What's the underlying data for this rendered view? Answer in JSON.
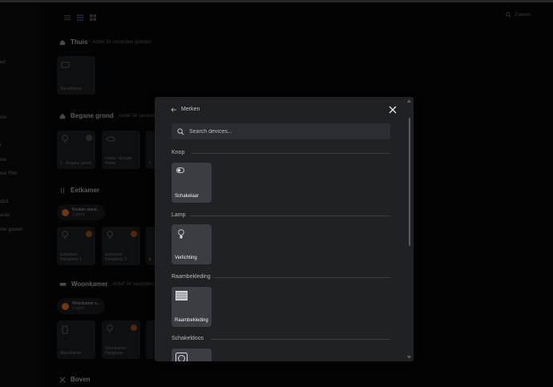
{
  "header": {
    "search_label": "Zoeken"
  },
  "sidebar": {
    "items": [
      "ed",
      "",
      "ner",
      "r",
      "ner",
      "ner Film",
      "dick",
      "ante",
      "ner gasten"
    ]
  },
  "background": {
    "sections": [
      {
        "title": "Thuis",
        "sub": "Actief 34 seconden geleden",
        "cards": [
          "Surveillance"
        ]
      },
      {
        "title": "Begane grond",
        "sub": "Actief 34 seconden",
        "cards": [
          "1 - Begane grond",
          "Living - Google Home",
          "F"
        ]
      },
      {
        "title": "Eetkamer",
        "sub": "",
        "chip": {
          "title": "Keuken stand...",
          "sub": "1 lights"
        },
        "cards": [
          "Eetkamer - Hanglamp 1",
          "Eetkamer - Hanglamp 2",
          "E"
        ]
      },
      {
        "title": "Woonkamer",
        "sub": "Actief 34 seconden",
        "chip": {
          "title": "Woonkamer s...",
          "sub": "1 lights"
        },
        "cards": [
          "Woonkamer",
          "Woonkamer - Hanglamp",
          ""
        ]
      },
      {
        "title": "Boven",
        "sub": "",
        "cards": []
      }
    ]
  },
  "modal": {
    "back_label": "Merken",
    "search_placeholder": "Search devices...",
    "categories": [
      {
        "title": "Knop",
        "device": {
          "label": "Schakelaar",
          "icon": "toggle-icon"
        }
      },
      {
        "title": "Lamp",
        "device": {
          "label": "Verlichting",
          "icon": "bulb-icon"
        }
      },
      {
        "title": "Raambekleding",
        "device": {
          "label": "Raambekleding",
          "icon": "blind-icon"
        }
      },
      {
        "title": "Schakeldoos",
        "device": {
          "label": "",
          "icon": "socket-icon"
        }
      }
    ]
  },
  "colors": {
    "modal_bg": "#202125",
    "card_bg": "#3b3d42",
    "accent_orange": "#a8551f"
  }
}
